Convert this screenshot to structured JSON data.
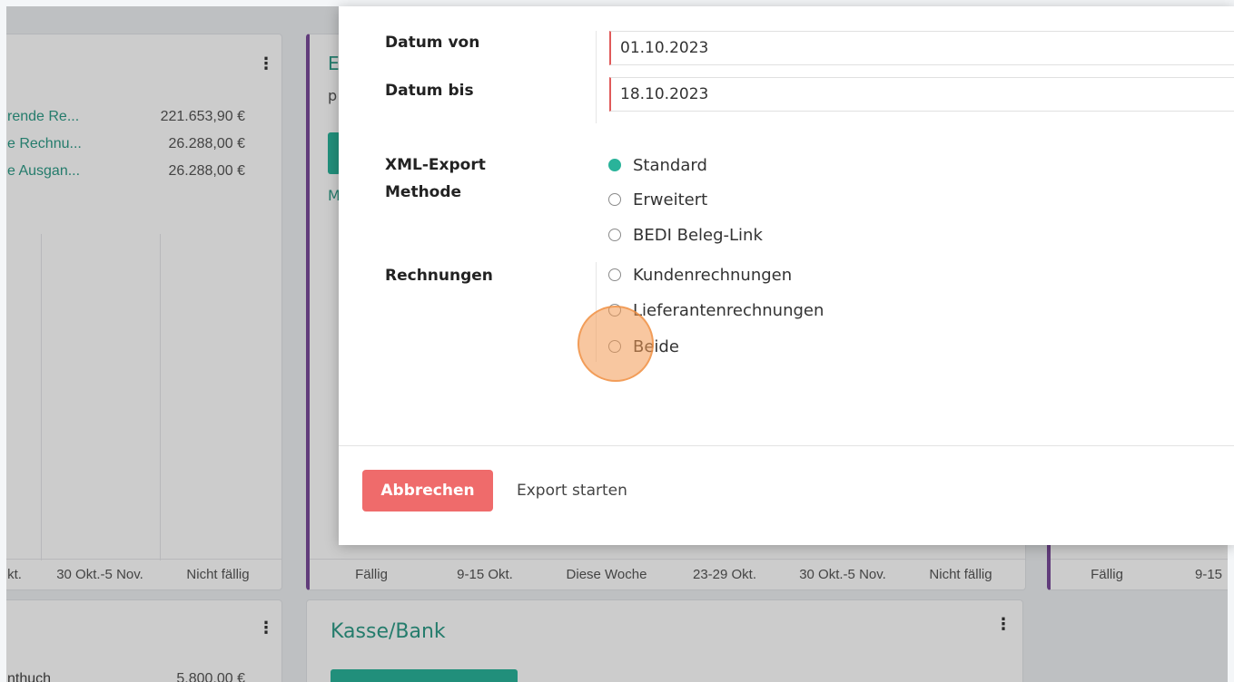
{
  "background": {
    "stats_card": {
      "rows": [
        {
          "label": "rende Re...",
          "value": "221.653,90 €"
        },
        {
          "label": "e Rechnu...",
          "value": "26.288,00 €"
        },
        {
          "label": "e Ausgan...",
          "value": "26.288,00 €"
        }
      ],
      "axis_ticks": [
        "kt.",
        "30 Okt.-5 Nov.",
        "Nicht fällig"
      ]
    },
    "middle_card": {
      "title_fragment": "E",
      "sub_fragment_1": "p",
      "sub_fragment_2": "M",
      "axis_ticks": [
        "Fällig",
        "9-15 Okt.",
        "Diese Woche",
        "23-29 Okt.",
        "30 Okt.-5 Nov.",
        "Nicht fällig"
      ]
    },
    "right_card": {
      "axis_ticks": [
        "Fällig",
        "9-15"
      ]
    },
    "bottom_left_card": {
      "label": "nthuch",
      "value": "5.800,00 €"
    },
    "bottom_mid_card": {
      "title": "Kasse/Bank"
    }
  },
  "dialog": {
    "date_from_label": "Datum von",
    "date_from_value": "01.10.2023",
    "date_to_label": "Datum bis",
    "date_to_value": "18.10.2023",
    "xml_method_label_line1": "XML-Export",
    "xml_method_label_line2": "Methode",
    "xml_options": [
      "Standard",
      "Erweitert",
      "BEDI Beleg-Link"
    ],
    "xml_selected": "Standard",
    "invoices_label": "Rechnungen",
    "invoice_options": [
      "Kundenrechnungen",
      "Lieferantenrechnungen",
      "Beide"
    ],
    "cancel_label": "Abbrechen",
    "export_label": "Export starten"
  },
  "colors": {
    "accent": "#2ab39a",
    "danger": "#ef6b6b",
    "sidebar_accent": "#7a4c9a",
    "click_marker": "#f39952"
  }
}
